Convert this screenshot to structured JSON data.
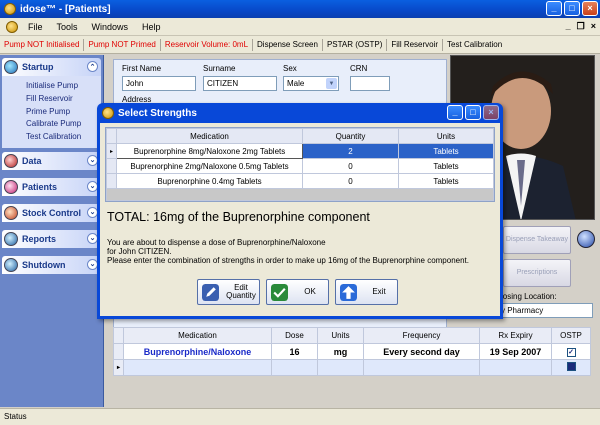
{
  "window": {
    "title": "idose™ - [Patients]"
  },
  "menu": {
    "items": [
      "File",
      "Tools",
      "Windows",
      "Help"
    ]
  },
  "toolbar": {
    "items": [
      {
        "label": "Pump NOT Initialised",
        "alert": true
      },
      {
        "label": "Pump NOT Primed",
        "alert": true
      },
      {
        "label": "Reservoir Volume: 0mL",
        "alert": true
      },
      {
        "label": "Dispense Screen",
        "alert": false
      },
      {
        "label": "PSTAR (OSTP)",
        "alert": false
      },
      {
        "label": "Fill Reservoir",
        "alert": false
      },
      {
        "label": "Test Calibration",
        "alert": false
      }
    ],
    "alert_color": "#e00000"
  },
  "sidebar": {
    "startup": {
      "label": "Startup",
      "links": [
        "Initialise Pump",
        "Fill Reservoir",
        "Prime Pump",
        "Calibrate Pump",
        "Test Calibration"
      ]
    },
    "groups": [
      "Data",
      "Patients",
      "Stock Control",
      "Reports",
      "Shutdown"
    ]
  },
  "patient": {
    "first_name_label": "First Name",
    "first_name": "John",
    "surname_label": "Surname",
    "surname": "CITIZEN",
    "sex_label": "Sex",
    "sex": "Male",
    "crn_label": "CRN",
    "crn": "",
    "address_label": "Address"
  },
  "side_actions": {
    "dispense_takeaway": "Dispense Takeaway",
    "prescriptions": "Prescriptions",
    "dosing_location_label": "Dosing Location:",
    "dosing_location": "y Pharmacy"
  },
  "prescription_grid": {
    "headers": [
      "Medication",
      "Dose",
      "Units",
      "Frequency",
      "Rx Expiry",
      "OSTP"
    ],
    "rows": [
      {
        "medication": "Buprenorphine/Naloxone",
        "dose": "16",
        "units": "mg",
        "frequency": "Every second day",
        "expiry": "19 Sep 2007",
        "ostp": "✓"
      }
    ]
  },
  "status": {
    "text": "Status"
  },
  "dialog": {
    "title": "Select Strengths",
    "headers": [
      "Medication",
      "Quantity",
      "Units"
    ],
    "rows": [
      {
        "medication": "Buprenorphine 8mg/Naloxone 2mg Tablets",
        "quantity": "2",
        "units": "Tablets"
      },
      {
        "medication": "Buprenorphine 2mg/Naloxone 0.5mg Tablets",
        "quantity": "0",
        "units": "Tablets"
      },
      {
        "medication": "Buprenorphine 0.4mg Tablets",
        "quantity": "0",
        "units": "Tablets"
      }
    ],
    "total": "TOTAL: 16mg of the Buprenorphine component",
    "message_line1": "You are about to dispense a dose of Buprenorphine/Naloxone",
    "message_line2": "for John CITIZEN.",
    "message_line3": "Please enter the combination of strengths in order to make up 16mg of the Buprenorphine component.",
    "buttons": {
      "edit": "Edit Quantity",
      "ok": "OK",
      "exit": "Exit"
    }
  }
}
